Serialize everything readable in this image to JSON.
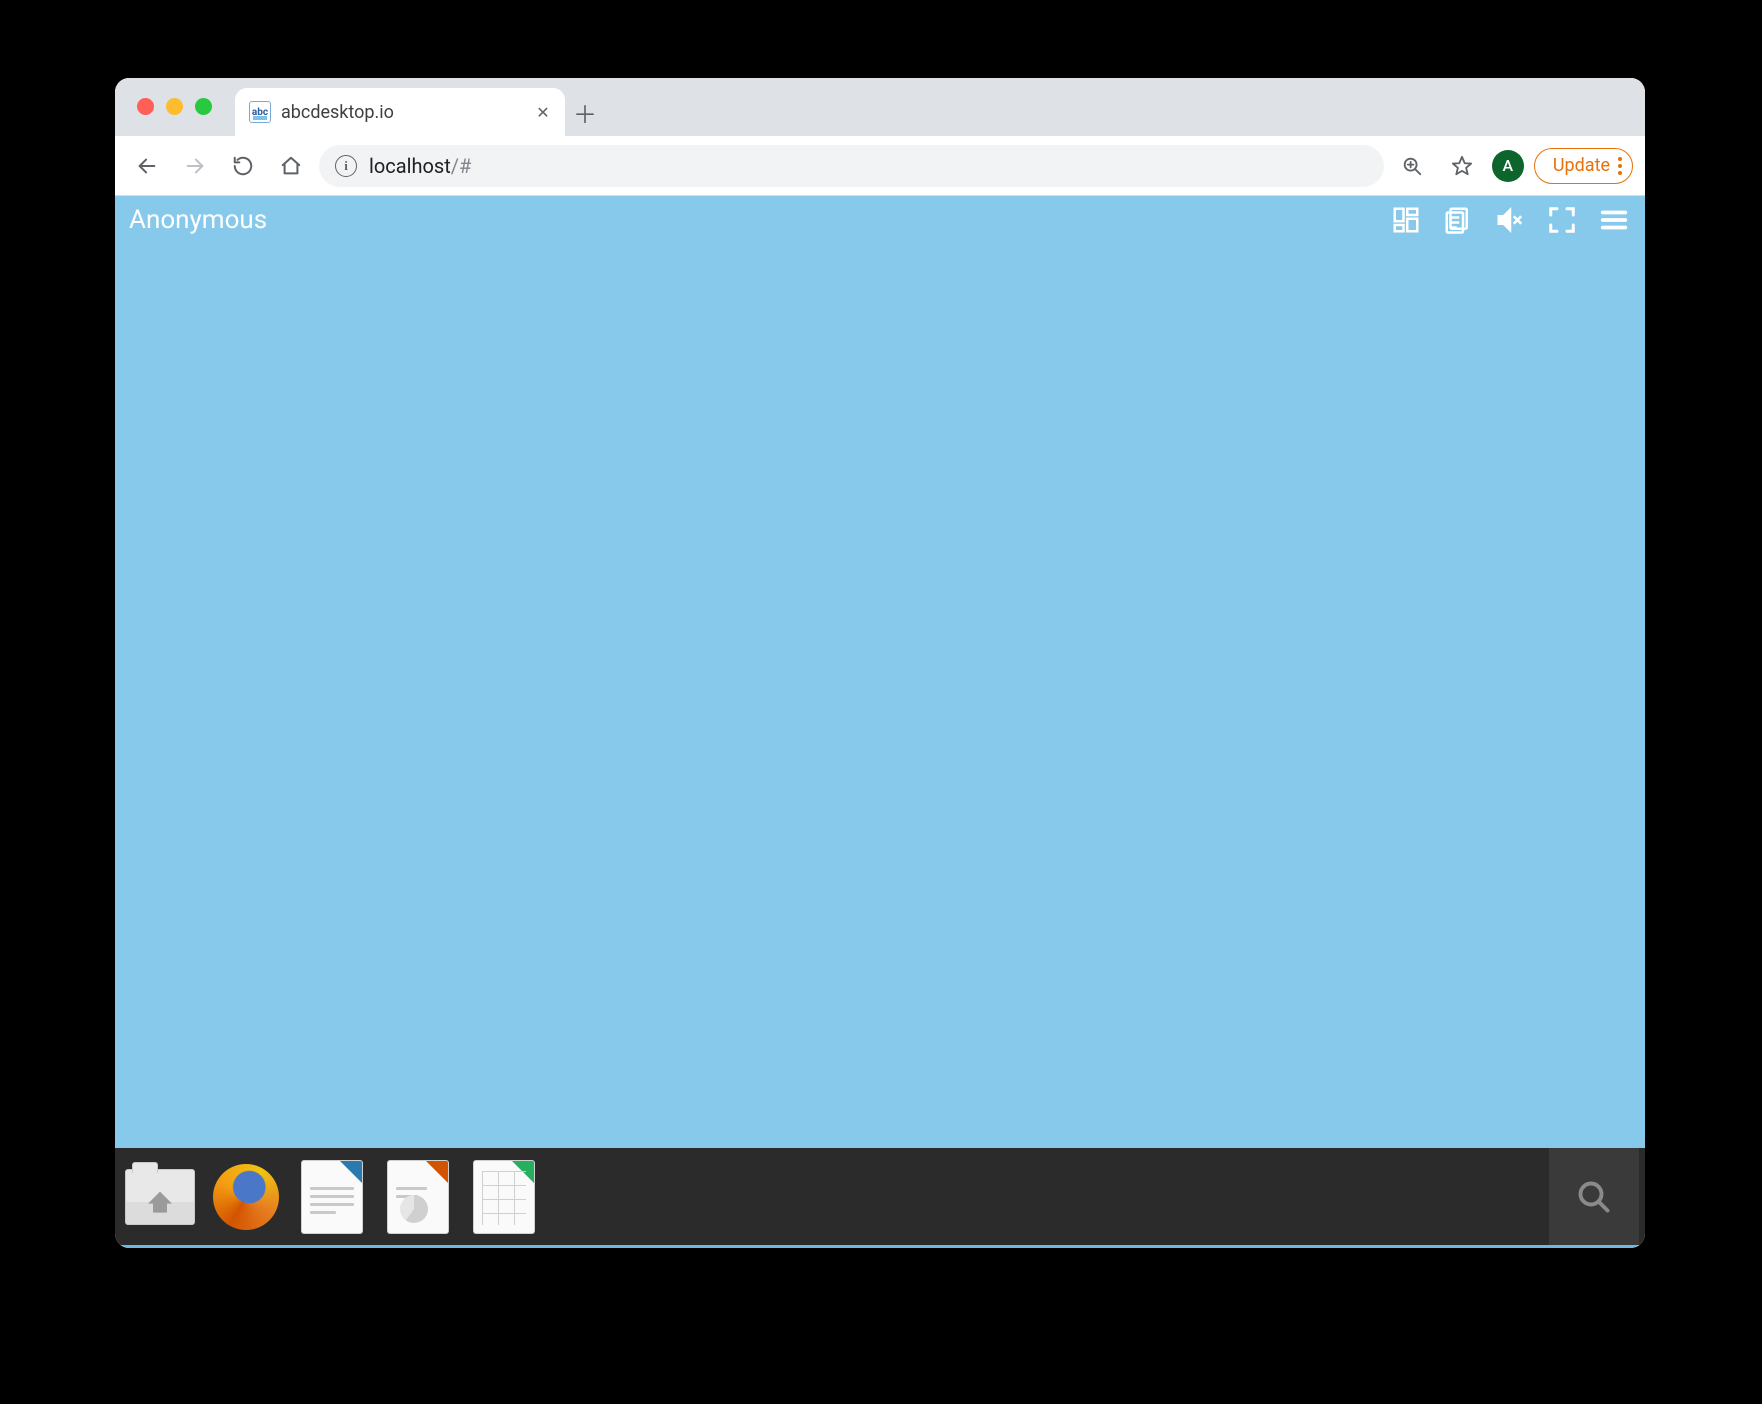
{
  "browser": {
    "tab": {
      "title": "abcdesktop.io",
      "favicon_text": "abc"
    },
    "address": {
      "host": "localhost",
      "path": "/#"
    },
    "avatar_initial": "A",
    "update_label": "Update"
  },
  "desktop": {
    "user_label": "Anonymous"
  },
  "dock": {
    "items": [
      {
        "name": "files"
      },
      {
        "name": "firefox"
      },
      {
        "name": "writer"
      },
      {
        "name": "impress"
      },
      {
        "name": "calc"
      }
    ]
  }
}
